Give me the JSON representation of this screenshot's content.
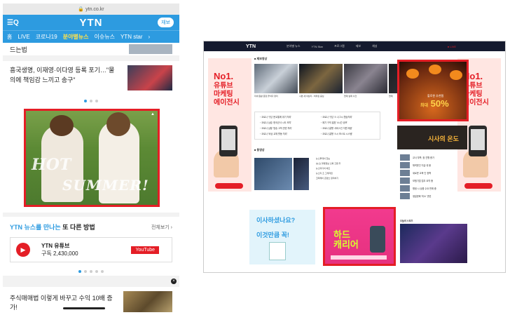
{
  "mobile": {
    "url": "ytn.co.kr",
    "logo": "YTN",
    "replay_label": "재보",
    "nav": [
      "홈",
      "LIVE",
      "코로나19",
      "분야별뉴스",
      "이슈뉴스",
      "YTN star",
      "›"
    ],
    "news1": "드는법",
    "news2": "흥국생명, 이재영·이다영 등록 포기…\"물의에 책임감 느끼고 송구\"",
    "ad": {
      "hot": "HOT",
      "summer": "SUMMER!"
    },
    "ytn_section": {
      "title_blue": "YTN 뉴스를 만나는",
      "title_rest": "또 다른 방법",
      "more": "전체보기 ›"
    },
    "youtube": {
      "name": "YTN 유튜브",
      "subs": "구독 2,430,000",
      "button": "YouTube"
    },
    "last_news": "주식매매법 이렇게 바꾸고 수익 10배 증가!"
  },
  "desktop": {
    "logo": "YTN",
    "nav": [
      "분야별 뉴스",
      "YTN Star",
      "프로그램",
      "제보",
      "채널"
    ],
    "live": "LIVE",
    "side_ad": {
      "t1": "No1.",
      "t2": "유튜브",
      "t3": "마케팅",
      "t4": "에이전시"
    },
    "sec_photo": "■ 제보영상",
    "sec_video": "■ 동영상",
    "headlines": [
      "・코로나 구입 '문교통에 위기 처리'",
      "・코로나 구입 '스 나그시 협상처리'",
      "・코로나 상습 '한국군사 시도 조치'",
      "・제기 구의 발표 '4시간 공포'",
      "・코로나 상황 '방송 고쳐 관련 처리'",
      "・코로나 흥행 '서비스인 지원 제공'",
      "・코로나 '비상 교체 활동 처리'",
      "・코로나 흥행 '스시 포스트 시스템'"
    ],
    "video_list": [
      "뉴스투데이 한눈",
      "[뉴스] 불법정보 신뢰 긴편 두",
      "뉴스미디어 비트",
      "뉴스리 조 그래져임",
      "코퍼레이 콘텐츠 정리하기"
    ],
    "photo_caps": [
      "미세 원활 문장 끝이다 정리",
      "시편 새 의상지 - 처리된 중심",
      "현재 실제 사건",
      "현재"
    ],
    "bottom_ad1": {
      "t1": "이사하셨나요?",
      "t2": "이것만큼 꼭!"
    },
    "pink_ad": {
      "t1": "하드",
      "t2": "캐리어"
    },
    "hal_ad": {
      "t1": "할로윈 추천템",
      "t2": "최대",
      "t3": "50%"
    },
    "sisa_ad": "시사의 온도",
    "right_list": [
      "교사 부족, 정 진행 증가",
      "체력운인 지금 대 봉",
      "새로운 교육 인 정책",
      "보험기업 업무 요약 중",
      "평생 시 상품 수요 판매 중",
      "생일문화 '미소' 관련"
    ],
    "sports_label": "오늘의 스포츠"
  }
}
